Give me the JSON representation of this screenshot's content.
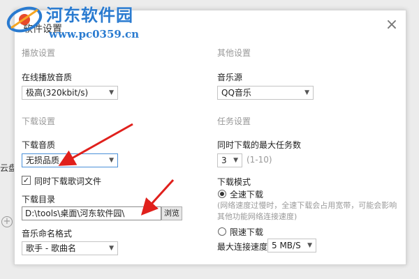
{
  "background": {
    "left_label": "云盘",
    "plus_icon": "+"
  },
  "watermark": {
    "site_name": "河东软件园",
    "url": "www.pc0359.cn"
  },
  "dialog": {
    "title": "软件设置",
    "close_glyph": "×",
    "playback": {
      "section": "播放设置",
      "quality_label": "在线播放音质",
      "quality_value": "极高(320kbit/s)"
    },
    "other": {
      "section": "其他设置",
      "source_label": "音乐源",
      "source_value": "QQ音乐"
    },
    "download": {
      "section": "下载设置",
      "quality_label": "下载音质",
      "quality_value": "无损品质",
      "lyrics_checkbox_label": "同时下载歌词文件",
      "lyrics_checked": true,
      "dir_label": "下载目录",
      "dir_value": "D:\\tools\\桌面\\河东软件园\\",
      "browse_label": "浏览",
      "naming_label": "音乐命名格式",
      "naming_value": "歌手 - 歌曲名"
    },
    "tasks": {
      "section": "任务设置",
      "max_tasks_label": "同时下载的最大任务数",
      "max_tasks_value": "3",
      "max_tasks_range": "(1-10)",
      "mode_label": "下载模式",
      "full_speed_label": "全速下载",
      "full_speed_hint": "(网络速度过慢时，全速下载会占用宽带，可能会影响其他功能网络连接速度)",
      "full_speed_selected": true,
      "limited_label": "限速下载",
      "max_speed_label": "最大连接速度",
      "max_speed_value": "5 MB/S"
    }
  },
  "colors": {
    "accent": "#2a7bd0",
    "annotation_arrow": "#e0201c",
    "section_text": "#999999"
  }
}
